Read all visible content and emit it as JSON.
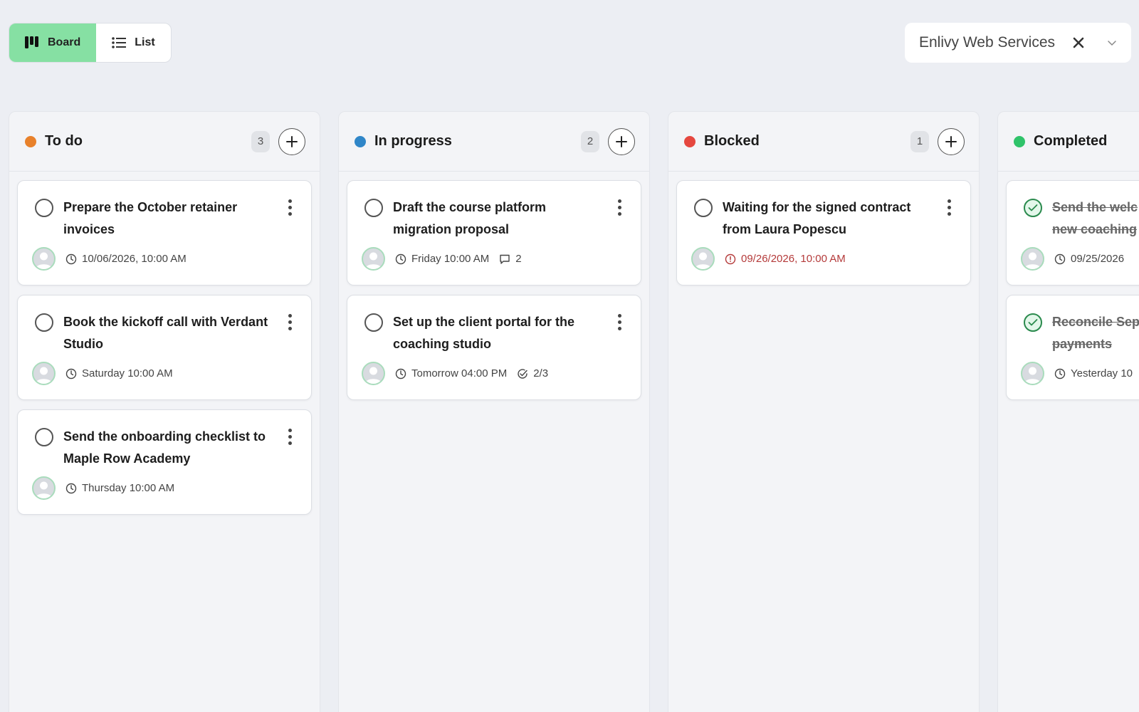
{
  "view_toggle": {
    "board_label": "Board",
    "list_label": "List",
    "active": "board"
  },
  "client_select": {
    "value": "Enlivy Web Services"
  },
  "colors": {
    "accent_green": "#86e0a3",
    "overdue": "#b43a3a"
  },
  "columns": [
    {
      "title": "To do",
      "count": "3",
      "dot_color": "#e8812b",
      "cards": [
        {
          "title": "Prepare the October retainer invoices",
          "due": "10/06/2026, 10:00 AM"
        },
        {
          "title": "Book the kickoff call with Verdant Studio",
          "due": "Saturday 10:00 AM"
        },
        {
          "title": "Send the onboarding checklist to Maple Row Academy",
          "due": "Thursday 10:00 AM"
        }
      ]
    },
    {
      "title": "In progress",
      "count": "2",
      "dot_color": "#2f86c8",
      "cards": [
        {
          "title": "Draft the course platform migration proposal",
          "due": "Friday 10:00 AM",
          "comments": "2"
        },
        {
          "title": "Set up the client portal for the coaching studio",
          "due": "Tomorrow 04:00 PM",
          "subtasks": "2/3"
        }
      ]
    },
    {
      "title": "Blocked",
      "count": "1",
      "dot_color": "#e5473f",
      "cards": [
        {
          "title": "Waiting for the signed contract from Laura Popescu",
          "due": "09/26/2026, 10:00 AM",
          "overdue": true
        }
      ]
    },
    {
      "title": "Completed",
      "dot_color": "#2fc36a",
      "cards": [
        {
          "title_line1": "Send the welc",
          "title_line2": "new coaching",
          "due": "09/25/2026"
        },
        {
          "title_line1": "Reconcile Sep",
          "title_line2": "payments",
          "due": "Yesterday 10"
        }
      ]
    }
  ]
}
